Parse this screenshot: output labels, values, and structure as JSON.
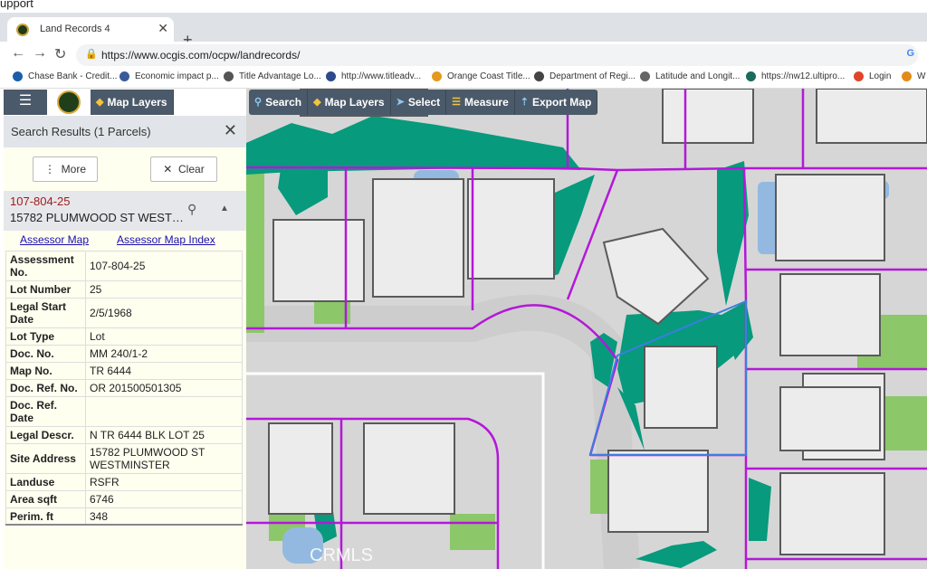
{
  "top_strip_text": "upport",
  "browser": {
    "tab_title": "Land Records 4",
    "url": "https://www.ocgis.com/ocpw/landrecords/",
    "bookmarks": [
      "Chase Bank - Credit...",
      "Economic impact p...",
      "Title Advantage Lo...",
      "http://www.titleadv...",
      "Orange Coast Title...",
      "Department of Regi...",
      "Latitude and Longit...",
      "https://nw12.ultipro...",
      "Login",
      "W"
    ]
  },
  "app": {
    "left_toolbar": {
      "map_layers": "Map Layers"
    },
    "map_toolbar": {
      "search": "Search",
      "map_layers": "Map Layers",
      "select": "Select",
      "measure": "Measure",
      "export_map": "Export Map"
    }
  },
  "panel": {
    "title": "Search Results (1 Parcels)",
    "more_label": "More",
    "clear_label": "Clear",
    "parcel_apn": "107-804-25",
    "parcel_address": "15782 PLUMWOOD ST WEST…",
    "assessor_map_link": "Assessor Map",
    "assessor_map_index_link": "Assessor Map Index",
    "attributes": [
      {
        "key": "Assessment No.",
        "value": "107-804-25"
      },
      {
        "key": "Lot Number",
        "value": "25"
      },
      {
        "key": "Legal Start Date",
        "value": "2/5/1968"
      },
      {
        "key": "Lot Type",
        "value": "Lot"
      },
      {
        "key": "Doc. No.",
        "value": "MM 240/1-2"
      },
      {
        "key": "Map No.",
        "value": "TR 6444"
      },
      {
        "key": "Doc. Ref. No.",
        "value": "OR 201500501305"
      },
      {
        "key": "Doc. Ref. Date",
        "value": ""
      },
      {
        "key": "Legal Descr.",
        "value": "N TR 6444 BLK LOT 25"
      },
      {
        "key": "Site Address",
        "value": "15782 PLUMWOOD ST WESTMINSTER"
      },
      {
        "key": "Landuse",
        "value": "RSFR"
      },
      {
        "key": "Area sqft",
        "value": "6746"
      },
      {
        "key": "Perim. ft",
        "value": "348"
      }
    ]
  },
  "map": {
    "watermark": "CRMLS"
  }
}
